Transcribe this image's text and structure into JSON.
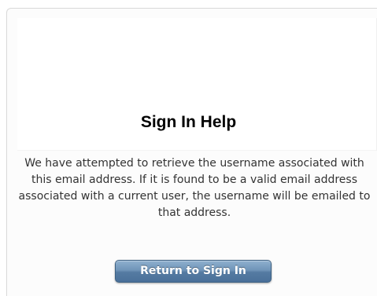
{
  "dialog": {
    "title": "Sign In Help",
    "message": "We have attempted to retrieve the username associated with this email address. If it is found to be a valid email address associated with a current user, the username will be emailed to that address.",
    "return_button_label": "Return to Sign In"
  },
  "colors": {
    "button_background": "#5a7fa6",
    "button_text": "#ffffff",
    "title_text": "#000000",
    "body_text": "#333333"
  }
}
